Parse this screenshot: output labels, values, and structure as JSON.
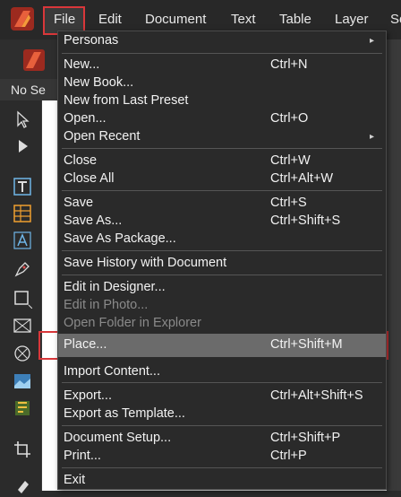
{
  "menubar": {
    "items": [
      "File",
      "Edit",
      "Document",
      "Text",
      "Table",
      "Layer",
      "Se"
    ]
  },
  "context": {
    "selection_text": "No Se"
  },
  "file_menu": {
    "items": [
      {
        "label": "Personas",
        "shortcut": "",
        "submenu": true,
        "enabled": true
      },
      {
        "label": "New...",
        "shortcut": "Ctrl+N",
        "submenu": false,
        "enabled": true
      },
      {
        "label": "New Book...",
        "shortcut": "",
        "submenu": false,
        "enabled": true
      },
      {
        "label": "New from Last Preset",
        "shortcut": "",
        "submenu": false,
        "enabled": true
      },
      {
        "label": "Open...",
        "shortcut": "Ctrl+O",
        "submenu": false,
        "enabled": true
      },
      {
        "label": "Open Recent",
        "shortcut": "",
        "submenu": true,
        "enabled": true
      },
      {
        "label": "Close",
        "shortcut": "Ctrl+W",
        "submenu": false,
        "enabled": true
      },
      {
        "label": "Close All",
        "shortcut": "Ctrl+Alt+W",
        "submenu": false,
        "enabled": true
      },
      {
        "label": "Save",
        "shortcut": "Ctrl+S",
        "submenu": false,
        "enabled": true
      },
      {
        "label": "Save As...",
        "shortcut": "Ctrl+Shift+S",
        "submenu": false,
        "enabled": true
      },
      {
        "label": "Save As Package...",
        "shortcut": "",
        "submenu": false,
        "enabled": true
      },
      {
        "label": "Save History with Document",
        "shortcut": "",
        "submenu": false,
        "enabled": true
      },
      {
        "label": "Edit in Designer...",
        "shortcut": "",
        "submenu": false,
        "enabled": true
      },
      {
        "label": "Edit in Photo...",
        "shortcut": "",
        "submenu": false,
        "enabled": false
      },
      {
        "label": "Open Folder in Explorer",
        "shortcut": "",
        "submenu": false,
        "enabled": false
      },
      {
        "label": "Place...",
        "shortcut": "Ctrl+Shift+M",
        "submenu": false,
        "enabled": true
      },
      {
        "label": "Import Content...",
        "shortcut": "",
        "submenu": false,
        "enabled": true
      },
      {
        "label": "Export...",
        "shortcut": "Ctrl+Alt+Shift+S",
        "submenu": false,
        "enabled": true
      },
      {
        "label": "Export as Template...",
        "shortcut": "",
        "submenu": false,
        "enabled": true
      },
      {
        "label": "Document Setup...",
        "shortcut": "Ctrl+Shift+P",
        "submenu": false,
        "enabled": true
      },
      {
        "label": "Print...",
        "shortcut": "Ctrl+P",
        "submenu": false,
        "enabled": true
      },
      {
        "label": "Exit",
        "shortcut": "",
        "submenu": false,
        "enabled": true
      }
    ],
    "submenu_arrow": "▸"
  },
  "colors": {
    "highlight_outline": "#d9373a",
    "hover_row": "#6b6b6b",
    "brand": "#e8603c"
  }
}
